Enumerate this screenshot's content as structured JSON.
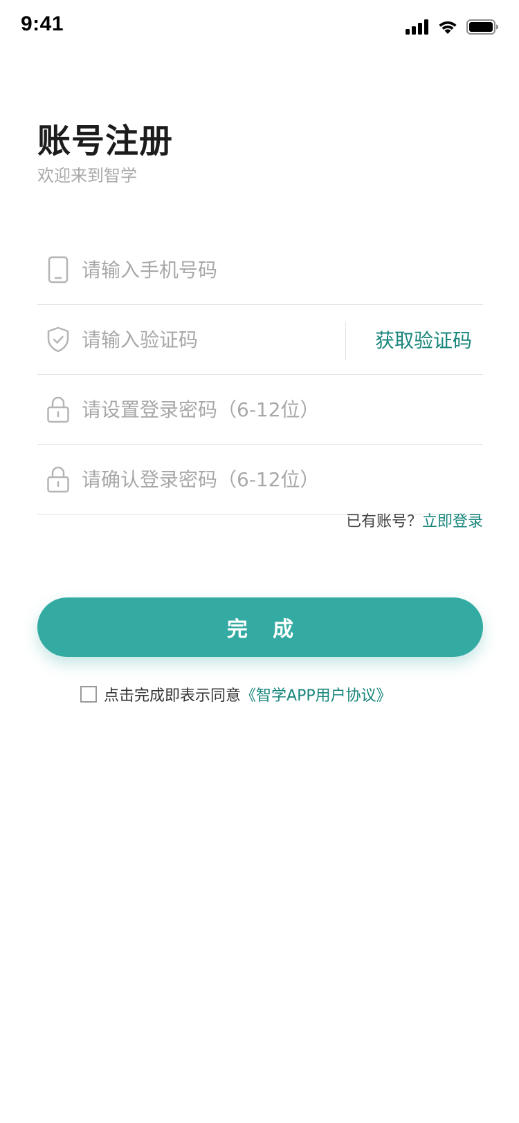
{
  "status_bar": {
    "time": "9:41",
    "icons": [
      "signal-icon",
      "wifi-icon",
      "battery-icon"
    ]
  },
  "header": {
    "title": "账号注册",
    "subtitle": "欢迎来到智学"
  },
  "form": {
    "phone": {
      "icon": "phone-icon",
      "value": "",
      "placeholder": "请输入手机号码"
    },
    "code": {
      "icon": "shield-check-icon",
      "value": "",
      "placeholder": "请输入验证码",
      "get_code_label": "获取验证码"
    },
    "password": {
      "icon": "lock-icon",
      "value": "",
      "placeholder": "请设置登录密码（6-12位）"
    },
    "confirm_password": {
      "icon": "lock-icon",
      "value": "",
      "placeholder": "请确认登录密码（6-12位）"
    }
  },
  "login": {
    "prompt": "已有账号？",
    "link": "立即登录"
  },
  "submit": {
    "label": "完 成"
  },
  "agreement": {
    "checked": false,
    "text": "点击完成即表示同意",
    "link": "《智学APP用户协议》"
  },
  "colors": {
    "accent": "#33aaa2",
    "link": "#17857b",
    "placeholder": "#a8a8a8",
    "divider": "#e3e3e3"
  }
}
